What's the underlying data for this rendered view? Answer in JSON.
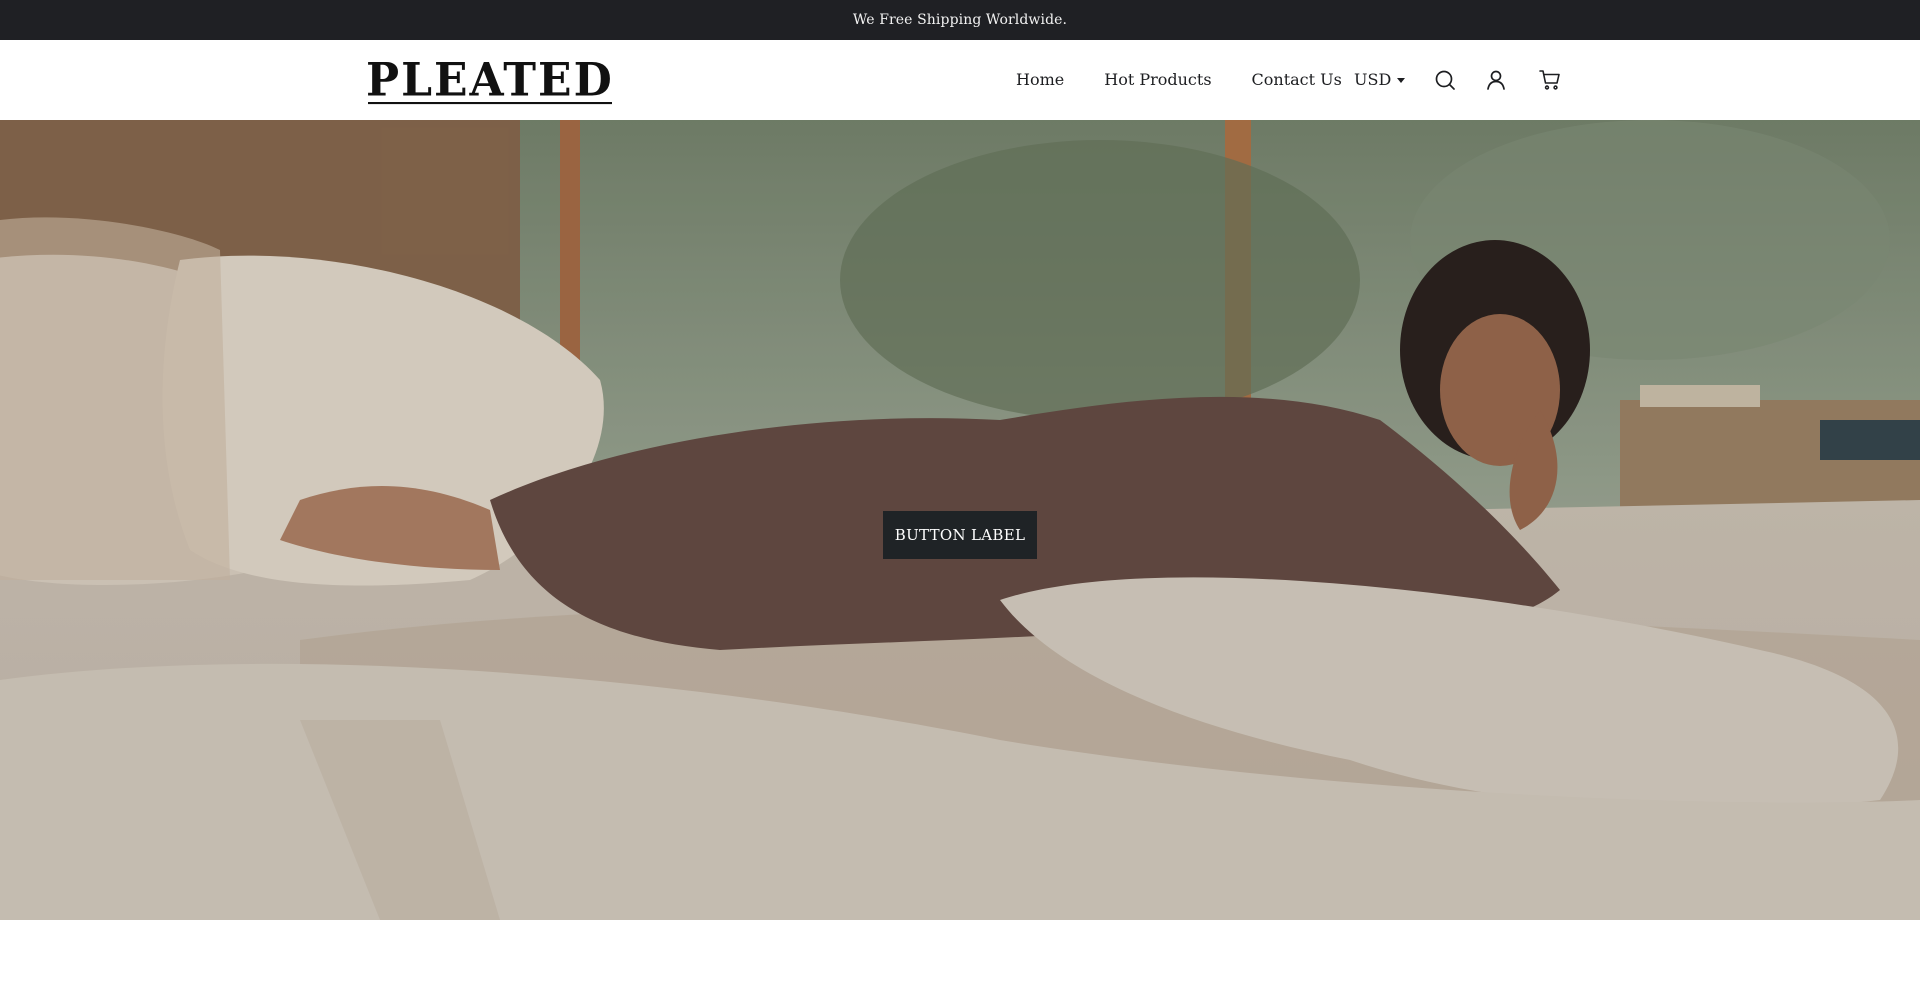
{
  "announcement": {
    "text": "We Free Shipping Worldwide."
  },
  "header": {
    "logo_text": "PLEATED",
    "nav": [
      {
        "label": "Home"
      },
      {
        "label": "Hot Products"
      },
      {
        "label": "Contact Us"
      }
    ],
    "currency": {
      "selected": "USD"
    },
    "icons": [
      "search-icon",
      "account-icon",
      "cart-icon"
    ]
  },
  "hero": {
    "button_label": "BUTTON LABEL"
  },
  "colors": {
    "announcement_bg": "#1f2024",
    "button_bg": "#1f2326",
    "text": "#1d1e21"
  }
}
